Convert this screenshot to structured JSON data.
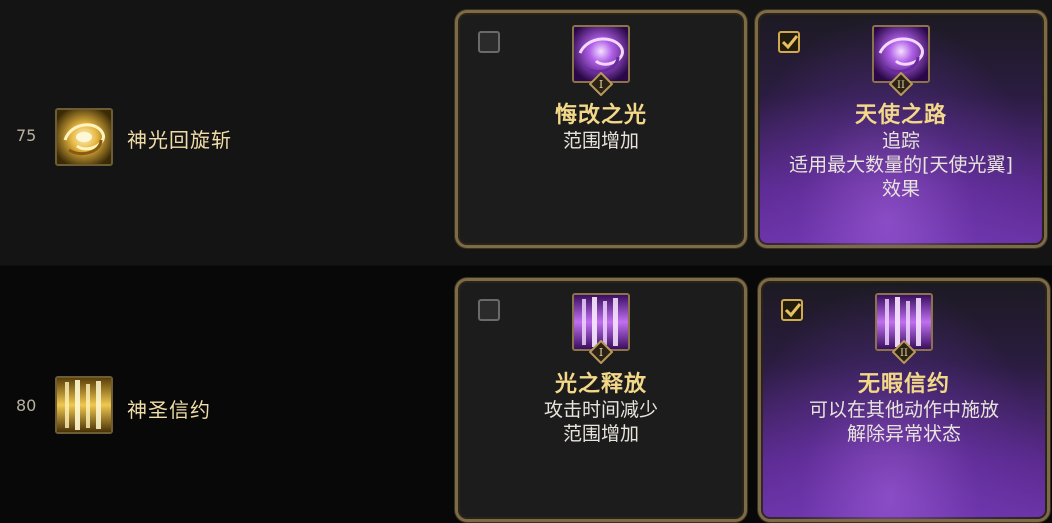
{
  "skills": [
    {
      "level": "75",
      "name": "神光回旋斩",
      "icon": "golden-spiral-icon",
      "options": [
        {
          "selected": false,
          "rune": "I",
          "title": "悔改之光",
          "lines": [
            "范围增加"
          ]
        },
        {
          "selected": true,
          "rune": "II",
          "title": "天使之路",
          "lines": [
            "追踪",
            "适用最大数量的[天使光翼]",
            "效果"
          ]
        }
      ]
    },
    {
      "level": "80",
      "name": "神圣信约",
      "icon": "golden-light-pillars-icon",
      "options": [
        {
          "selected": false,
          "rune": "I",
          "title": "光之释放",
          "lines": [
            "攻击时间减少",
            "范围增加"
          ]
        },
        {
          "selected": true,
          "rune": "II",
          "title": "无暇信约",
          "lines": [
            "可以在其他动作中施放",
            "解除异常状态"
          ]
        }
      ]
    }
  ],
  "colors": {
    "title": "#f2d888",
    "skill_name": "#f0dca8",
    "card_border": "#7d6a46",
    "selected_purple": "#6c34a8"
  }
}
